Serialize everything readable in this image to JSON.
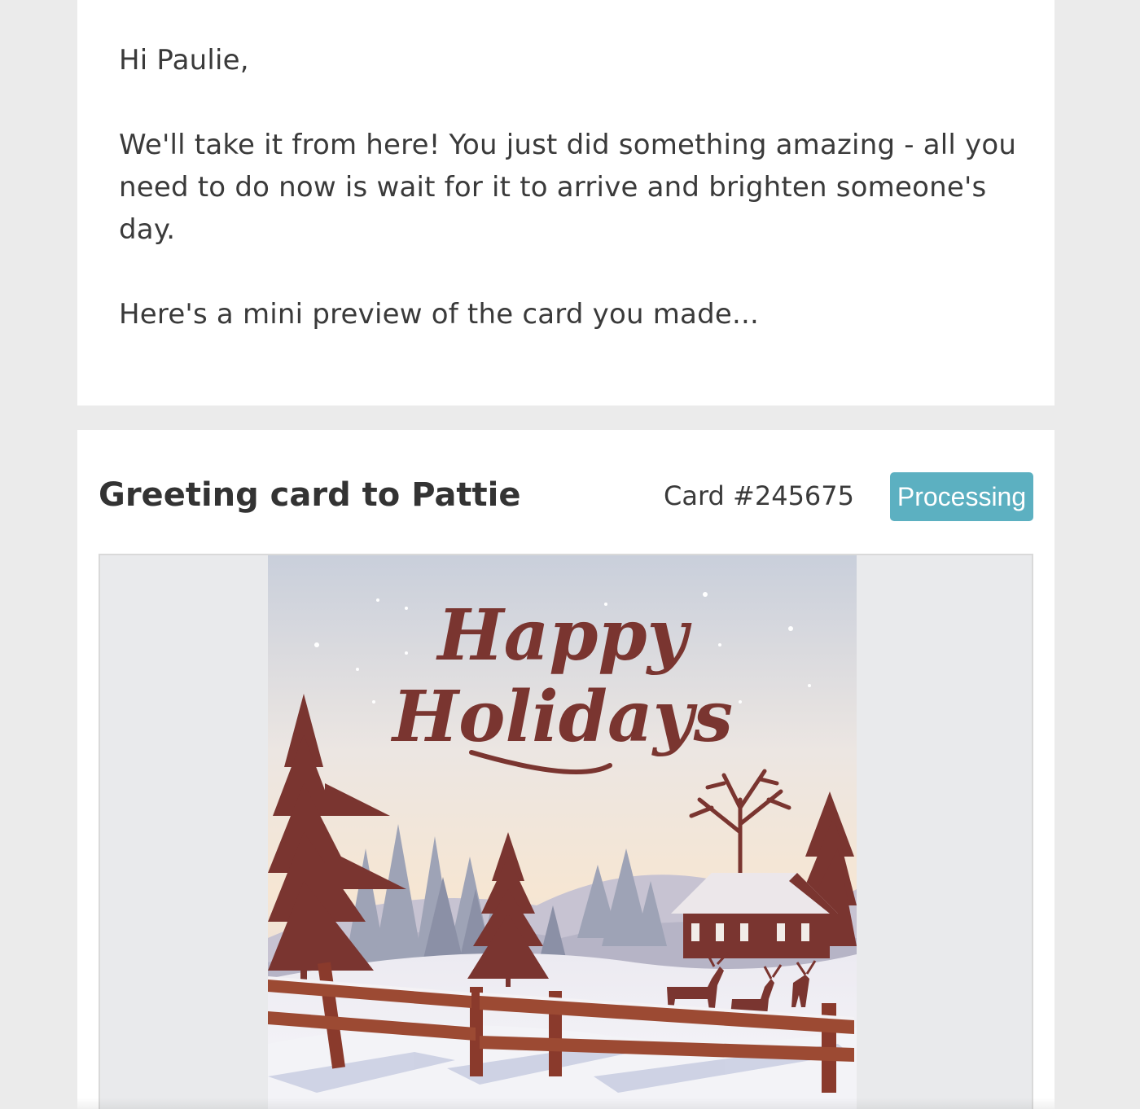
{
  "email": {
    "greeting": "Hi Paulie,",
    "message": "We'll take it from here! You just did something amazing - all you need to do now is wait for it to arrive and brighten someone's day.",
    "preview_note": "Here's a mini preview of the card you made..."
  },
  "card": {
    "title": "Greeting card to Pattie",
    "number": "Card #245675",
    "status": "Processing",
    "status_color": "#5cb0c1",
    "preview_text_line1": "Happy",
    "preview_text_line2": "Holidays"
  },
  "colors": {
    "page_background": "#ebebeb",
    "panel_background": "#ffffff",
    "text": "#3a3a3a",
    "card_accent": "#7a3530"
  }
}
